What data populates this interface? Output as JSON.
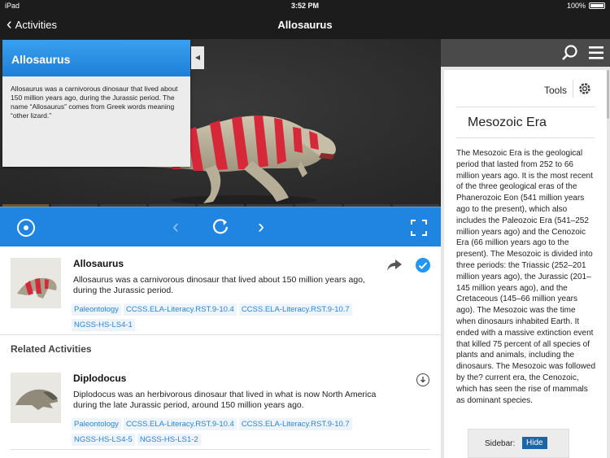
{
  "status": {
    "carrier": "iPad",
    "time": "3:52 PM",
    "battery": "100%"
  },
  "nav": {
    "back_label": "Activities",
    "title": "Allosaurus"
  },
  "info_card": {
    "title": "Allosaurus",
    "text": "Allosaurus was a carnivorous dinosaur that lived about 150 million years ago, during the Jurassic period. The name “Allosaurus” comes from Greek words meaning “other lizard.”"
  },
  "activity": {
    "name": "Allosaurus",
    "description": "Allosaurus was a carnivorous dinosaur that lived about 150 million years ago, during the Jurassic period.",
    "tags": [
      "Paleontology",
      "CCSS.ELA-Literacy.RST.9-10.4",
      "CCSS.ELA-Literacy.RST.9-10.7",
      "NGSS-HS-LS4-1"
    ]
  },
  "related": {
    "title": "Related Activities",
    "items": [
      {
        "name": "Diplodocus",
        "description": "Diplodocus was an herbivorous dinosaur that lived in what is now North America during the late Jurassic period, around 150 million years ago.",
        "tags": [
          "Paleontology",
          "CCSS.ELA-Literacy.RST.9-10.4",
          "CCSS.ELA-Literacy.RST.9-10.7",
          "NGSS-HS-LS4-5",
          "NGSS-HS-LS1-2"
        ]
      }
    ]
  },
  "sidebar": {
    "tools_label": "Tools",
    "era_title": "Mesozoic Era",
    "era_text": "The Mesozoic Era is the geological period that lasted from 252 to 66 million years ago. It is the most recent of the three geological eras of the Phanerozoic Eon (541 million years ago to the present), which also includes the Paleozoic Era (541–252 million years ago) and the Cenozoic Era (66 million years ago to the present). The Mesozoic is divided into three periods: the Triassic (252–201 million years ago), the Jurassic (201–145 million years ago), and the Cretaceous (145–66 million years ago). The Mesozoic was the time when dinosaurs inhabited Earth. It ended with a massive extinction event that killed 75 percent of all species of plants and animals, including the dinosaurs. The Mesozoic was followed by the? current era, the Cenozoic, which has seen the rise of mammals as dominant species.",
    "toggle_label": "Sidebar:",
    "hide_label": "Hide"
  },
  "colors": {
    "accent": "#1f85e0",
    "tag_text": "#2a85d8",
    "hide_button": "#1a66a8"
  },
  "icons": [
    "chevron-left-icon",
    "search-icon",
    "hamburger-menu-icon",
    "gear-icon",
    "record-icon",
    "refresh-icon",
    "fullscreen-icon",
    "share-icon",
    "checkmark-icon",
    "download-icon"
  ]
}
